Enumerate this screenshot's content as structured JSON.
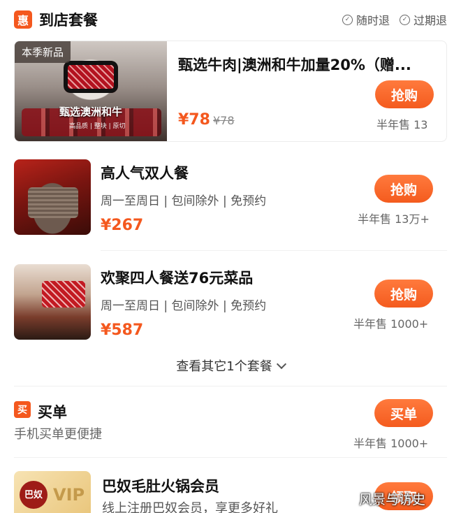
{
  "header": {
    "badge": "惠",
    "title": "到店套餐",
    "guarantees": [
      "随时退",
      "过期退"
    ]
  },
  "featured": {
    "season_tag": "本季新品",
    "thumb_caption": "甄选澳洲和牛",
    "thumb_sub": "高品质 | 整块 | 原切",
    "title": "甄选牛肉|澳洲和牛加量20%（赠...",
    "price": "¥78",
    "original_price": "¥78",
    "button": "抢购",
    "sold": "半年售 13"
  },
  "packages": [
    {
      "title": "高人气双人餐",
      "tags": "周一至周日 | 包间除外 | 免预约",
      "price": "¥267",
      "button": "抢购",
      "sold": "半年售 13万+"
    },
    {
      "title": "欢聚四人餐送76元菜品",
      "tags": "周一至周日 | 包间除外 | 免预约",
      "price": "¥587",
      "button": "抢购",
      "sold": "半年售 1000+"
    }
  ],
  "more_link": "查看其它1个套餐",
  "maidan": {
    "badge": "买",
    "title": "买单",
    "subtitle": "手机买单更便捷",
    "button": "买单",
    "sold": "半年售 1000+"
  },
  "vip": {
    "logo": "巴奴",
    "badge": "VIP",
    "title": "巴奴毛肚火锅会员",
    "subtitle": "线上注册巴奴会员，享更多好礼",
    "button": "领取"
  },
  "watermark": "风景与访史",
  "colors": {
    "accent": "#f4581e",
    "text": "#111111",
    "muted": "#666666"
  }
}
